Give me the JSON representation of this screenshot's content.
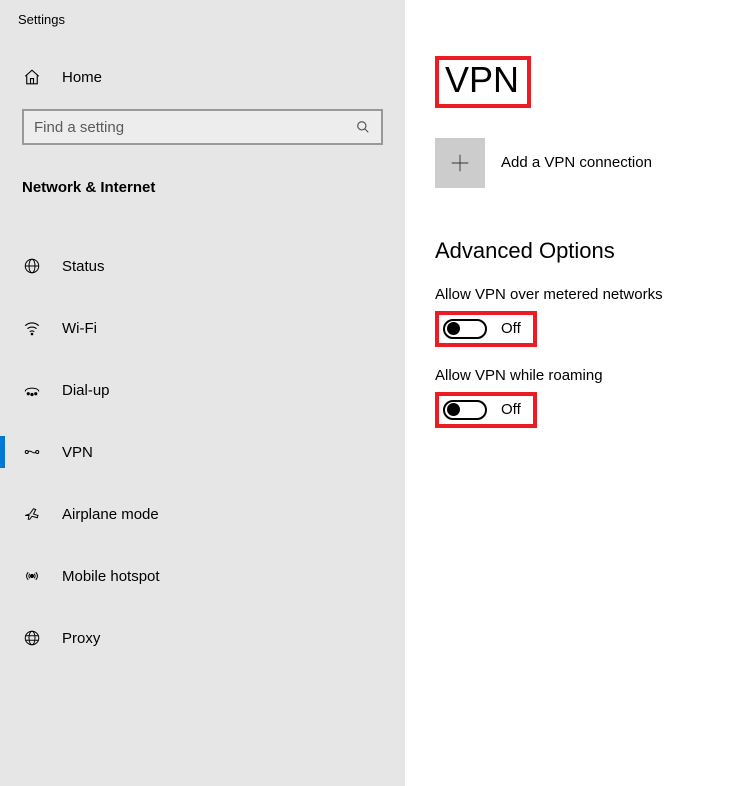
{
  "window_title": "Settings",
  "home": {
    "label": "Home"
  },
  "search": {
    "placeholder": "Find a setting"
  },
  "section": "Network & Internet",
  "nav_items": [
    {
      "label": "Status"
    },
    {
      "label": "Wi-Fi"
    },
    {
      "label": "Dial-up"
    },
    {
      "label": "VPN"
    },
    {
      "label": "Airplane mode"
    },
    {
      "label": "Mobile hotspot"
    },
    {
      "label": "Proxy"
    }
  ],
  "page_title": "VPN",
  "add_connection": {
    "label": "Add a VPN connection"
  },
  "advanced_heading": "Advanced Options",
  "options": {
    "metered": {
      "label": "Allow VPN over metered networks",
      "state": "Off"
    },
    "roaming": {
      "label": "Allow VPN while roaming",
      "state": "Off"
    }
  },
  "highlight_color": "#ed1c24"
}
